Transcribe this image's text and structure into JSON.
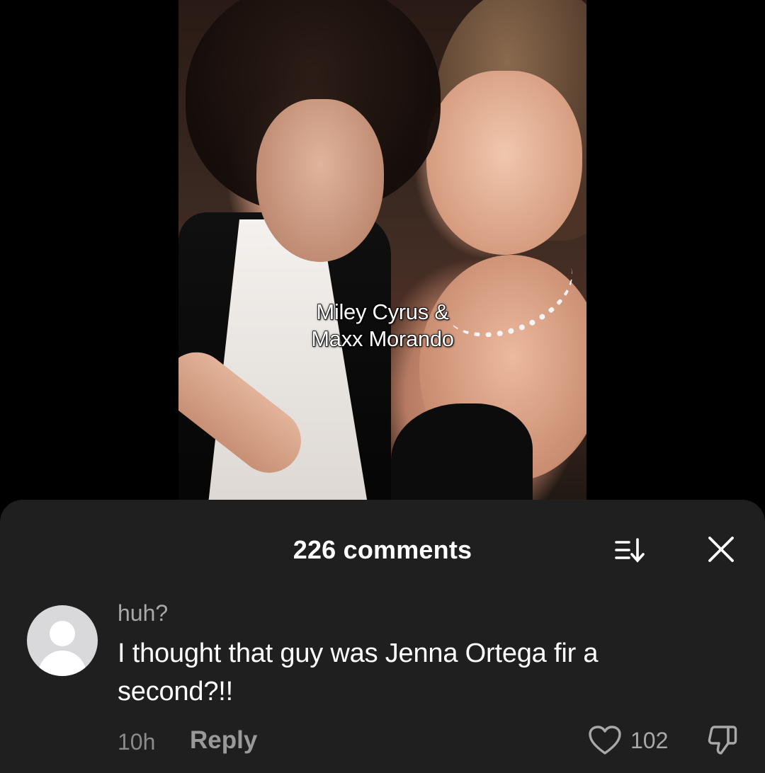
{
  "video": {
    "caption_lines": [
      "Miley Cyrus &",
      "Maxx Morando"
    ]
  },
  "comments_panel": {
    "title": "226 comments",
    "sort_icon": "sort-icon",
    "close_icon": "close-icon",
    "comment": {
      "username": "huh?",
      "text": "I thought that guy was Jenna Ortega fir a second?!!",
      "timestamp": "10h",
      "reply_label": "Reply",
      "like_count": "102",
      "like_icon": "heart-icon",
      "dislike_icon": "thumbs-down-icon"
    }
  },
  "colors": {
    "background": "#000000",
    "sheet_background": "#1f1f1f",
    "primary_text": "#ffffff",
    "secondary_text": "#a8a8a8",
    "avatar_placeholder": "#d9d9db"
  }
}
